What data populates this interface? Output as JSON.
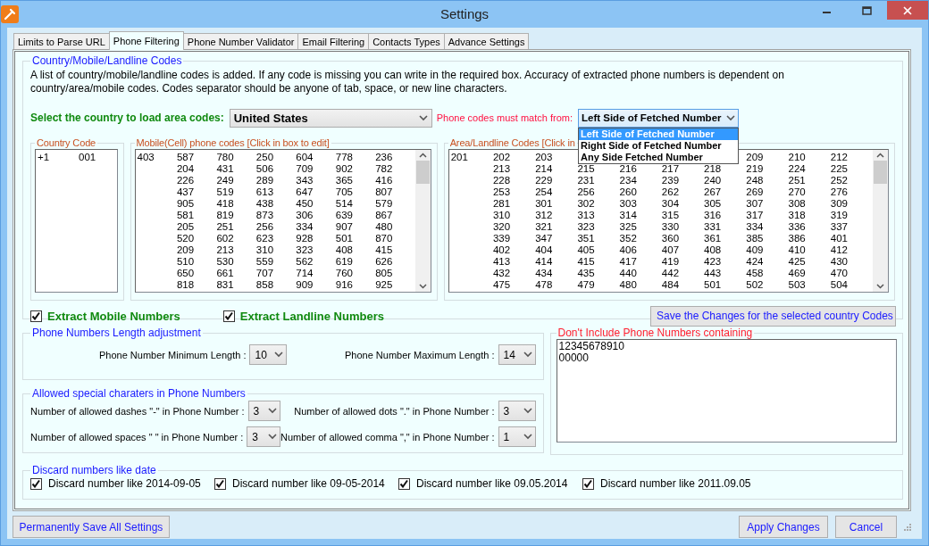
{
  "window": {
    "title": "Settings"
  },
  "tabs": [
    {
      "label": "Limits to Parse URL",
      "selected": false
    },
    {
      "label": "Phone Filtering",
      "selected": true
    },
    {
      "label": "Phone Number Validator",
      "selected": false
    },
    {
      "label": "Email Filtering",
      "selected": false
    },
    {
      "label": "Contacts Types",
      "selected": false
    },
    {
      "label": "Advance Settings",
      "selected": false
    }
  ],
  "codes_group": {
    "legend": "Country/Mobile/Landline Codes",
    "description": "A list of country/mobile/landline codes is added. If any code is missing you can write in the required box. Accuracy of extracted phone numbers is dependent on country/area/mobile codes. Codes separator should be anyone of tab, space, or new line characters.",
    "country_label": "Select the country to load area codes:",
    "country_select": "United States",
    "match_label": "Phone codes must match from:",
    "match_select": "Left Side of Fetched Number",
    "match_options": [
      {
        "label": "Left Side of Fetched Number",
        "selected": true
      },
      {
        "label": "Right Side of Fetched Number",
        "selected": false
      },
      {
        "label": "Any Side Fetched Number",
        "selected": false
      }
    ],
    "country_code": {
      "legend": "Country Code",
      "lead": "+1",
      "rows": [
        [
          "001"
        ]
      ]
    },
    "mobile_codes": {
      "legend": "Mobile(Cell) phone codes  [Click in box to edit]",
      "lead": "403",
      "rows": [
        [
          "587",
          "780",
          "250",
          "604",
          "778",
          "236"
        ],
        [
          "204",
          "431",
          "506",
          "709",
          "902",
          "782"
        ],
        [
          "226",
          "249",
          "289",
          "343",
          "365",
          "416"
        ],
        [
          "437",
          "519",
          "613",
          "647",
          "705",
          "807"
        ],
        [
          "905",
          "418",
          "438",
          "450",
          "514",
          "579"
        ],
        [
          "581",
          "819",
          "873",
          "306",
          "639",
          "867"
        ],
        [
          "205",
          "251",
          "256",
          "334",
          "907",
          "480"
        ],
        [
          "520",
          "602",
          "623",
          "928",
          "501",
          "870"
        ],
        [
          "209",
          "213",
          "310",
          "323",
          "408",
          "415"
        ],
        [
          "510",
          "530",
          "559",
          "562",
          "619",
          "626"
        ],
        [
          "650",
          "661",
          "707",
          "714",
          "760",
          "805"
        ],
        [
          "818",
          "831",
          "858",
          "909",
          "916",
          "925"
        ]
      ]
    },
    "area_codes": {
      "legend": "Area/Landline Codes [Click in",
      "lead": "201",
      "rows": [
        [
          "202",
          "203",
          null,
          null,
          null,
          null,
          "209",
          "210",
          "212"
        ],
        [
          "213",
          "214",
          "215",
          "216",
          "217",
          "218",
          "219",
          "224",
          "225"
        ],
        [
          "228",
          "229",
          "231",
          "234",
          "239",
          "240",
          "248",
          "251",
          "252"
        ],
        [
          "253",
          "254",
          "256",
          "260",
          "262",
          "267",
          "269",
          "270",
          "276"
        ],
        [
          "281",
          "301",
          "302",
          "303",
          "304",
          "305",
          "307",
          "308",
          "309"
        ],
        [
          "310",
          "312",
          "313",
          "314",
          "315",
          "316",
          "317",
          "318",
          "319"
        ],
        [
          "320",
          "321",
          "323",
          "325",
          "330",
          "331",
          "334",
          "336",
          "337"
        ],
        [
          "339",
          "347",
          "351",
          "352",
          "360",
          "361",
          "385",
          "386",
          "401"
        ],
        [
          "402",
          "404",
          "405",
          "406",
          "407",
          "408",
          "409",
          "410",
          "412"
        ],
        [
          "413",
          "414",
          "415",
          "417",
          "419",
          "423",
          "424",
          "425",
          "430"
        ],
        [
          "432",
          "434",
          "435",
          "440",
          "442",
          "443",
          "458",
          "469",
          "470"
        ],
        [
          "475",
          "478",
          "479",
          "480",
          "484",
          "501",
          "502",
          "503",
          "504"
        ]
      ]
    },
    "extract": [
      {
        "label": "Extract Mobile Numbers",
        "checked": true
      },
      {
        "label": "Extract Landline Numbers",
        "checked": true
      }
    ],
    "save_button": "Save the Changes for the selected country Codes"
  },
  "length_group": {
    "legend": "Phone Numbers Length adjustment",
    "fields": [
      {
        "label": "Phone Number Minimum Length :",
        "value": "10"
      },
      {
        "label": "Phone Number Maximum Length :",
        "value": "14"
      }
    ]
  },
  "special_group": {
    "legend": "Allowed special charaters in Phone Numbers",
    "fields": [
      {
        "label": "Number of allowed dashes \"-\" in Phone Number :",
        "value": "3"
      },
      {
        "label": "Number of allowed dots \".\" in Phone Number :",
        "value": "3"
      },
      {
        "label": "Number of allowed spaces \" \" in Phone Number :",
        "value": "3"
      },
      {
        "label": "Number of allowed  comma \",\" in Phone Number :",
        "value": "1"
      }
    ]
  },
  "exclude_group": {
    "legend": "Don't Include Phone Numbers containing",
    "lines": [
      "12345678910",
      "00000"
    ]
  },
  "date_group": {
    "legend": "Discard numbers like date",
    "options": [
      {
        "label": "Discard number like 2014-09-05",
        "checked": true
      },
      {
        "label": "Discard number like 09-05-2014",
        "checked": true
      },
      {
        "label": "Discard number like 09.05.2014",
        "checked": true
      },
      {
        "label": "Discard number like 2011.09.05",
        "checked": true
      }
    ]
  },
  "buttons": {
    "left": "Permanently Save All Settings",
    "right": [
      "Apply Changes",
      "Cancel"
    ]
  }
}
